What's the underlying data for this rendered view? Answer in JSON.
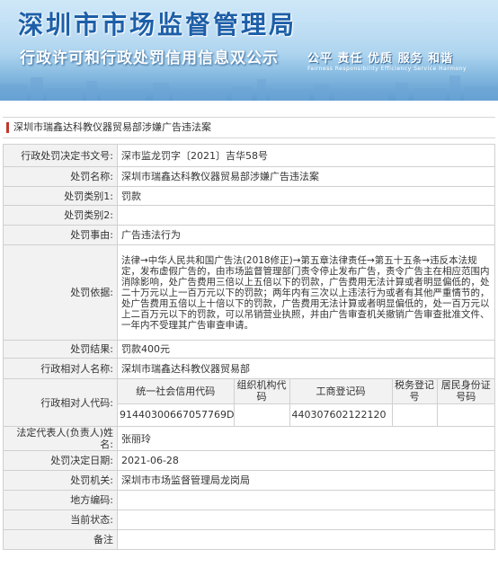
{
  "header": {
    "title": "深圳市市场监督管理局",
    "subtitle": "行政许可和行政处罚信用信息双公示",
    "motto": "公平 责任 优质 服务 和谐",
    "motto_en": "Fairness Responsibility Efficiency Service Harmony"
  },
  "case_title": "深圳市瑞鑫达科教仪器贸易部涉嫌广告违法案",
  "rows": {
    "decision_no": {
      "label": "行政处罚决定书文号:",
      "value": "深市监龙罚字〔2021〕吉华58号"
    },
    "case_name": {
      "label": "处罚名称:",
      "value": "深圳市瑞鑫达科教仪器贸易部涉嫌广告违法案"
    },
    "category1": {
      "label": "处罚类别1:",
      "value": "罚款"
    },
    "category2": {
      "label": "处罚类别2:",
      "value": ""
    },
    "reason": {
      "label": "处罚事由:",
      "value": "广告违法行为"
    },
    "basis": {
      "label": "处罚依据:",
      "value": "法律→中华人民共和国广告法(2018修正)→第五章法律责任→第五十五条→违反本法规定，发布虚假广告的，由市场监督管理部门责令停止发布广告，责令广告主在相应范围内消除影响，处广告费用三倍以上五倍以下的罚款，广告费用无法计算或者明显偏低的，处二十万元以上一百万元以下的罚款；两年内有三次以上违法行为或者有其他严重情节的，处广告费用五倍以上十倍以下的罚款，广告费用无法计算或者明显偏低的，处一百万元以上二百万元以下的罚款，可以吊销营业执照，并由广告审查机关撤销广告审查批准文件、一年内不受理其广告审查申请。"
    },
    "result": {
      "label": "处罚结果:",
      "value": "罚款400元"
    },
    "party_name": {
      "label": "行政相对人名称:",
      "value": "深圳市瑞鑫达科教仪器贸易部"
    },
    "party_codes": {
      "label": "行政相对人代码:",
      "headers": [
        "统一社会信用代码",
        "组织机构代码",
        "工商登记码",
        "税务登记号",
        "居民身份证号码"
      ],
      "values": [
        "91440300667057769D",
        "",
        "440307602122120",
        "",
        ""
      ]
    },
    "legal_rep": {
      "label": "法定代表人(负责人)姓名:",
      "value": "张丽玲"
    },
    "decision_date": {
      "label": "处罚决定日期:",
      "value": "2021-06-28"
    },
    "authority": {
      "label": "处罚机关:",
      "value": "深圳市市场监督管理局龙岗局"
    },
    "area_code": {
      "label": "地方编码:",
      "value": ""
    },
    "status": {
      "label": "当前状态:",
      "value": ""
    },
    "remarks": {
      "label": "备注",
      "value": ""
    }
  },
  "colors": {
    "title_blue": "#1d5fa8",
    "accent_red": "#c0392b",
    "label_bg": "#f2f2f2"
  }
}
